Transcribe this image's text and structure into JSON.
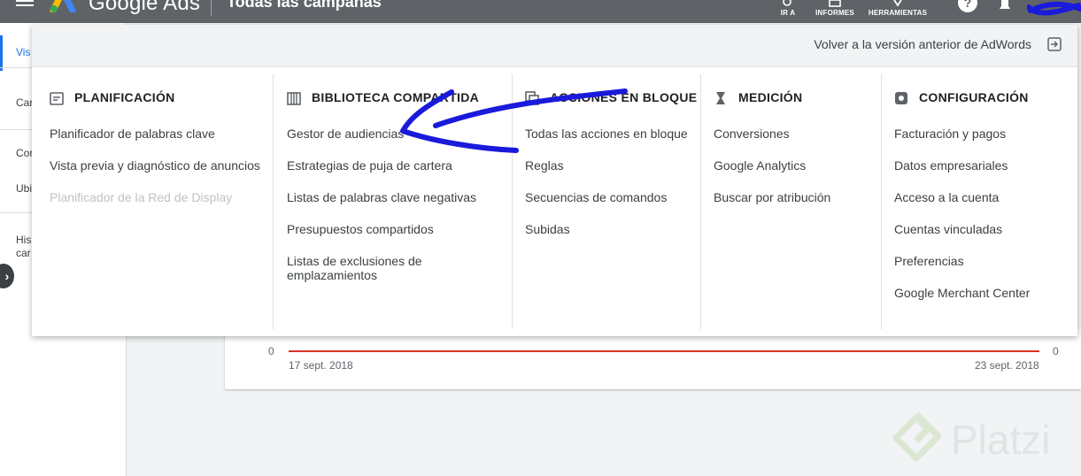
{
  "topbar": {
    "brand": "Google Ads",
    "campaign_title": "Todas las campañas",
    "tools": [
      {
        "label": "IR A",
        "icon": "search-icon"
      },
      {
        "label": "INFORMES",
        "icon": "chart-icon"
      },
      {
        "label": "HERRAMIENTAS",
        "icon": "wrench-icon"
      }
    ],
    "help_glyph": "?",
    "colors": {
      "bar": "#5f6368",
      "accent": "#1a73e8"
    }
  },
  "leftnav": {
    "items": [
      "Vis",
      "Car",
      "Cor",
      "Ubi",
      "His",
      "car"
    ],
    "collapse_glyph": "›"
  },
  "chart_card": {
    "y_tick_left": "0",
    "y_tick_right": "0",
    "start_date": "17 sept. 2018",
    "end_date": "23 sept. 2018",
    "line_color": "#d93025"
  },
  "menu": {
    "back_link": "Volver a la versión anterior de AdWords",
    "columns": [
      {
        "title": "PLANIFICACIÓN",
        "icon": "calendar-icon",
        "items": [
          {
            "label": "Planificador de palabras clave",
            "disabled": false
          },
          {
            "label": "Vista previa y diagnóstico de anuncios",
            "disabled": false
          },
          {
            "label": "Planificador de la Red de Display",
            "disabled": true
          }
        ]
      },
      {
        "title": "BIBLIOTECA COMPARTIDA",
        "icon": "library-icon",
        "items": [
          {
            "label": "Gestor de audiencias"
          },
          {
            "label": "Estrategias de puja de cartera"
          },
          {
            "label": "Listas de palabras clave negativas"
          },
          {
            "label": "Presupuestos compartidos"
          },
          {
            "label": "Listas de exclusiones de emplazamientos"
          }
        ]
      },
      {
        "title": "ACCIONES EN BLOQUE",
        "icon": "copy-icon",
        "items": [
          {
            "label": "Todas las acciones en bloque"
          },
          {
            "label": "Reglas"
          },
          {
            "label": "Secuencias de comandos"
          },
          {
            "label": "Subidas"
          }
        ]
      },
      {
        "title": "MEDICIÓN",
        "icon": "hourglass-icon",
        "items": [
          {
            "label": "Conversiones"
          },
          {
            "label": "Google Analytics"
          },
          {
            "label": "Buscar por atribución"
          }
        ]
      },
      {
        "title": "CONFIGURACIÓN",
        "icon": "gear-icon",
        "items": [
          {
            "label": "Facturación y pagos"
          },
          {
            "label": "Datos empresariales"
          },
          {
            "label": "Acceso a la cuenta"
          },
          {
            "label": "Cuentas vinculadas"
          },
          {
            "label": "Preferencias"
          },
          {
            "label": "Google Merchant Center"
          }
        ]
      }
    ]
  },
  "watermark": {
    "text": "Platzi"
  },
  "annotation": {
    "color": "#1a1adb"
  }
}
